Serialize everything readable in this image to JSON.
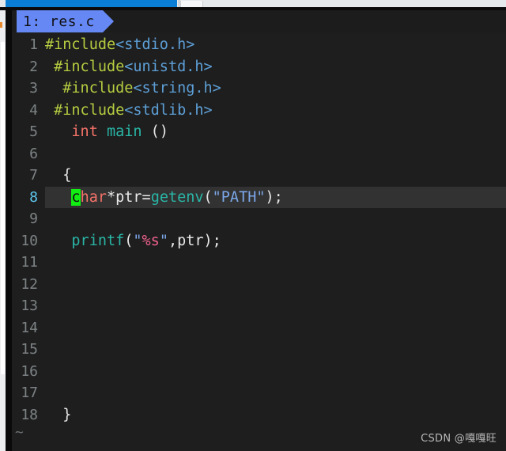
{
  "window": {
    "browser_bar": {
      "progress_label": "",
      "accent_color": "#0a7ed4",
      "bar_background": "#e6e9eb"
    },
    "scrollbar": {
      "name": "left-scrollbar",
      "mark_color": "#e8892c"
    }
  },
  "editor": {
    "app": "vim",
    "background": "#1e1e1e",
    "tab": {
      "label": "1: res.c",
      "background": "#6688f5",
      "text_color": "#101010"
    },
    "cursor": {
      "line": 8,
      "column": 4,
      "char": "c",
      "color": "#12ef12"
    },
    "current_line_highlight": "#323232",
    "empty_buffer_marker": "~",
    "gutter_color": "#7d8385",
    "current_line_number_color": "#5fc8ef",
    "lines": [
      {
        "num": "1",
        "tokens": [
          {
            "text": "#include",
            "type": "preproc"
          },
          {
            "text": "<stdio.h>",
            "type": "header"
          }
        ]
      },
      {
        "num": "2",
        "tokens": [
          {
            "text": " ",
            "type": "plain"
          },
          {
            "text": "#include",
            "type": "preproc"
          },
          {
            "text": "<unistd.h>",
            "type": "header"
          }
        ]
      },
      {
        "num": "3",
        "tokens": [
          {
            "text": "  ",
            "type": "plain"
          },
          {
            "text": "#include",
            "type": "preproc"
          },
          {
            "text": "<string.h>",
            "type": "header"
          }
        ]
      },
      {
        "num": "4",
        "tokens": [
          {
            "text": " ",
            "type": "plain"
          },
          {
            "text": "#include",
            "type": "preproc"
          },
          {
            "text": "<stdlib.h>",
            "type": "header"
          }
        ]
      },
      {
        "num": "5",
        "tokens": [
          {
            "text": "   ",
            "type": "plain"
          },
          {
            "text": "int",
            "type": "keyword"
          },
          {
            "text": " ",
            "type": "plain"
          },
          {
            "text": "main",
            "type": "function"
          },
          {
            "text": " ()",
            "type": "punct"
          }
        ]
      },
      {
        "num": "6",
        "tokens": []
      },
      {
        "num": "7",
        "tokens": [
          {
            "text": "  ",
            "type": "plain"
          },
          {
            "text": "{",
            "type": "punct"
          }
        ]
      },
      {
        "num": "8",
        "current": true,
        "tokens": [
          {
            "text": "   ",
            "type": "plain"
          },
          {
            "text": "c",
            "type": "cursor"
          },
          {
            "text": "har",
            "type": "keyword"
          },
          {
            "text": "*ptr=",
            "type": "punct"
          },
          {
            "text": "getenv",
            "type": "function"
          },
          {
            "text": "(",
            "type": "punct"
          },
          {
            "text": "\"PATH\"",
            "type": "string"
          },
          {
            "text": ")",
            "type": "punct"
          },
          {
            "text": ";",
            "type": "punct"
          }
        ]
      },
      {
        "num": "9",
        "tokens": []
      },
      {
        "num": "10",
        "tokens": [
          {
            "text": "   ",
            "type": "plain"
          },
          {
            "text": "printf",
            "type": "function"
          },
          {
            "text": "(",
            "type": "punct"
          },
          {
            "text": "\"",
            "type": "string"
          },
          {
            "text": "%s",
            "type": "format"
          },
          {
            "text": "\"",
            "type": "string"
          },
          {
            "text": ",ptr);",
            "type": "punct"
          }
        ]
      },
      {
        "num": "11",
        "tokens": []
      },
      {
        "num": "12",
        "tokens": []
      },
      {
        "num": "13",
        "tokens": []
      },
      {
        "num": "14",
        "tokens": []
      },
      {
        "num": "15",
        "tokens": []
      },
      {
        "num": "16",
        "tokens": []
      },
      {
        "num": "17",
        "tokens": []
      },
      {
        "num": "18",
        "tokens": [
          {
            "text": "  ",
            "type": "plain"
          },
          {
            "text": "}",
            "type": "punct"
          }
        ]
      }
    ]
  },
  "watermark": {
    "text": "CSDN @嘎嘎旺"
  }
}
